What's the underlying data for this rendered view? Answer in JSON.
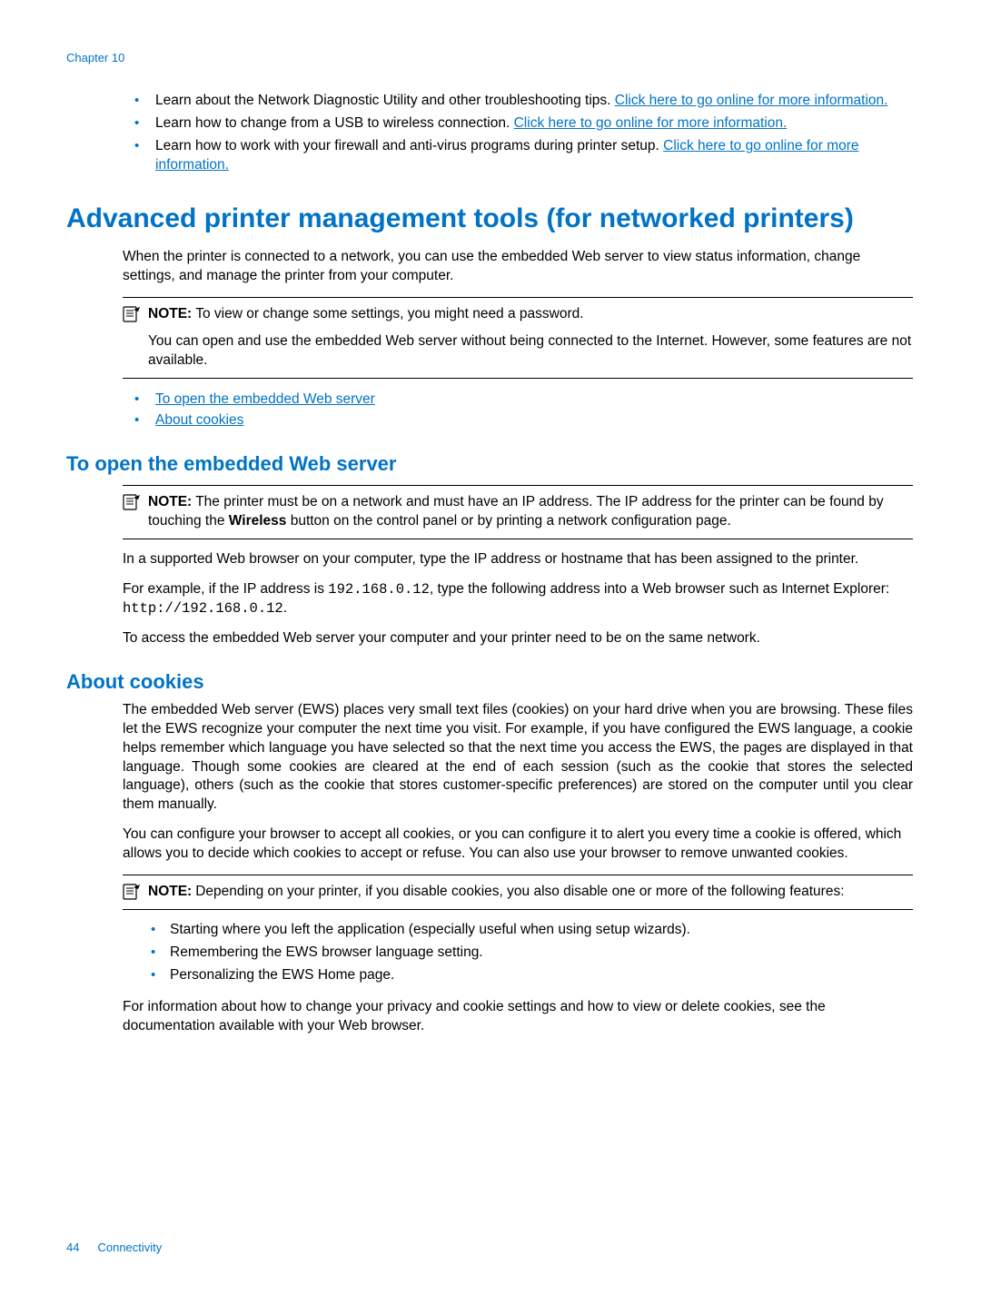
{
  "header": {
    "chapter": "Chapter 10"
  },
  "top_bullets": [
    {
      "pre": "Learn about the Network Diagnostic Utility and other troubleshooting tips. ",
      "link": "Click here to go online for more information.",
      "post": ""
    },
    {
      "pre": "Learn how to change from a USB to wireless connection. ",
      "link": "Click here to go online for more information.",
      "post": ""
    },
    {
      "pre": "Learn how to work with your firewall and anti-virus programs during printer setup. ",
      "link": "Click here to go online for more information.",
      "post": ""
    }
  ],
  "main": {
    "heading": "Advanced printer management tools (for networked printers)",
    "intro": "When the printer is connected to a network, you can use the embedded Web server to view status information, change settings, and manage the printer from your computer.",
    "note1": {
      "label": "NOTE:",
      "text": "To view or change some settings, you might need a password.",
      "extra": "You can open and use the embedded Web server without being connected to the Internet. However, some features are not available."
    },
    "toc": [
      "To open the embedded Web server",
      "About cookies"
    ]
  },
  "section_open": {
    "heading": "To open the embedded Web server",
    "note": {
      "label": "NOTE:",
      "text_pre": "The printer must be on a network and must have an IP address. The IP address for the printer can be found by touching the ",
      "bold": "Wireless",
      "text_post": " button on the control panel or by printing a network configuration page."
    },
    "p1": "In a supported Web browser on your computer, type the IP address or hostname that has been assigned to the printer.",
    "p2_pre": "For example, if the IP address is ",
    "p2_code1": "192.168.0.12",
    "p2_mid": ", type the following address into a Web browser such as Internet Explorer: ",
    "p2_code2": "http://192.168.0.12",
    "p2_post": ".",
    "p3": "To access the embedded Web server your computer and your printer need to be on the same network."
  },
  "section_cookies": {
    "heading": "About cookies",
    "p1": "The embedded Web server (EWS) places very small text files (cookies) on your hard drive when you are browsing. These files let the EWS recognize your computer the next time you visit. For example, if you have configured the EWS language, a cookie helps remember which language you have selected so that the next time you access the EWS, the pages are displayed in that language. Though some cookies are cleared at the end of each session (such as the cookie that stores the selected language), others (such as the cookie that stores customer-specific preferences) are stored on the computer until you clear them manually.",
    "p2": "You can configure your browser to accept all cookies, or you can configure it to alert you every time a cookie is offered, which allows you to decide which cookies to accept or refuse. You can also use your browser to remove unwanted cookies.",
    "note": {
      "label": "NOTE:",
      "text": "Depending on your printer, if you disable cookies, you also disable one or more of the following features:"
    },
    "features": [
      "Starting where you left the application (especially useful when using setup wizards).",
      "Remembering the EWS browser language setting.",
      "Personalizing the EWS Home page."
    ],
    "p3": "For information about how to change your privacy and cookie settings and how to view or delete cookies, see the documentation available with your Web browser."
  },
  "footer": {
    "page": "44",
    "section": "Connectivity"
  }
}
